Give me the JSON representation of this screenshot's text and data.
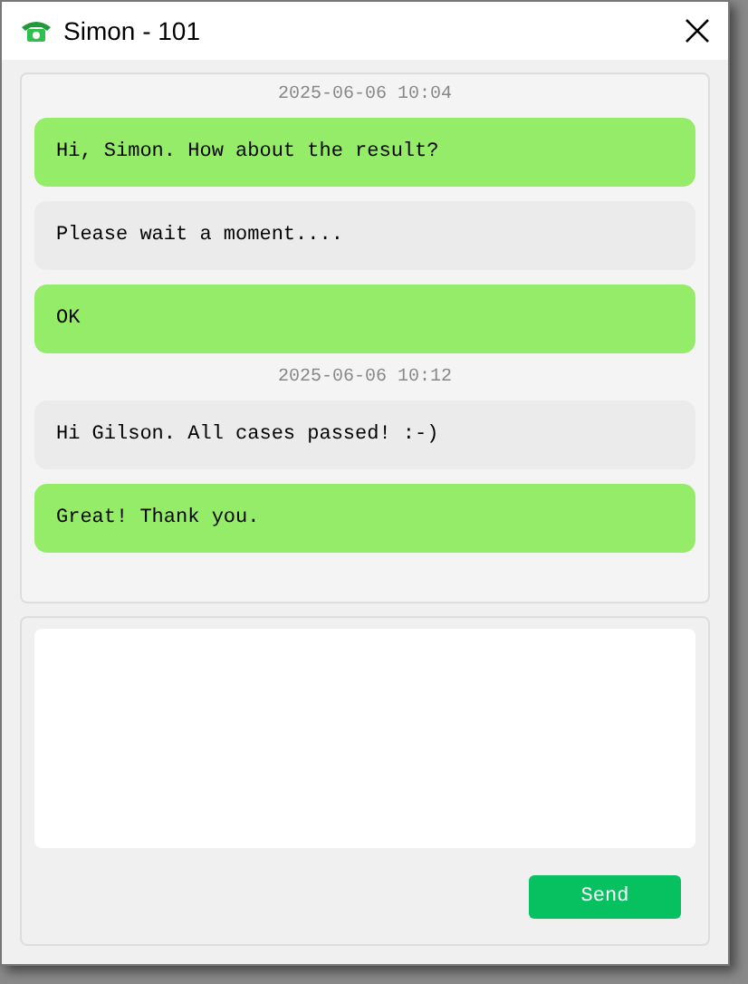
{
  "window": {
    "title": "Simon - 101"
  },
  "messages": [
    {
      "kind": "timestamp",
      "text": "2025-06-06 10:04"
    },
    {
      "kind": "sent",
      "text": "Hi, Simon. How about the result?"
    },
    {
      "kind": "received",
      "text": "Please wait a moment...."
    },
    {
      "kind": "sent",
      "text": "OK"
    },
    {
      "kind": "timestamp",
      "text": "2025-06-06 10:12"
    },
    {
      "kind": "received",
      "text": "Hi Gilson. All cases passed! :-)"
    },
    {
      "kind": "sent",
      "text": "Great! Thank you."
    }
  ],
  "buttons": [
    "Send"
  ]
}
